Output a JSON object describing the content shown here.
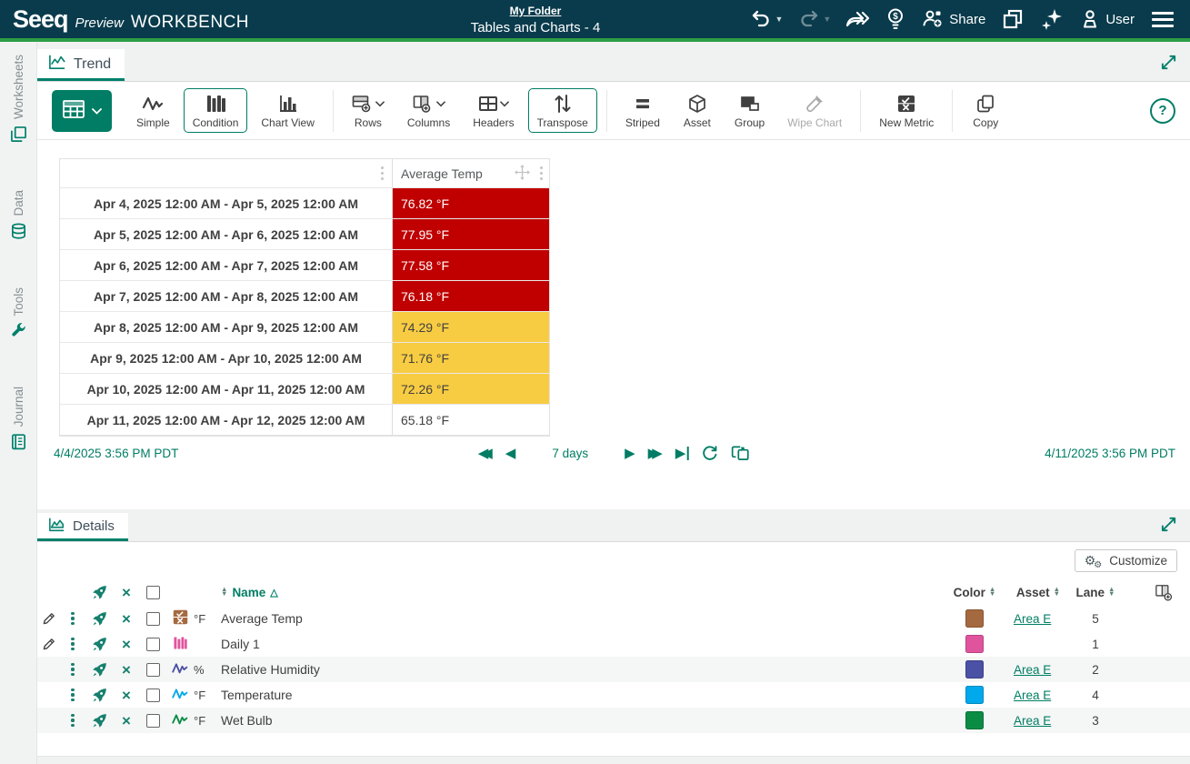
{
  "theme": {
    "accent": "#007d64",
    "header_bg": "#093b4c",
    "header_line": "#2d9e47",
    "alarm_high": "#c00000",
    "alarm_warn": "#f8cc42"
  },
  "header": {
    "brand": "Seeq",
    "preview": "Preview",
    "product": "WORKBENCH",
    "breadcrumb": "My Folder",
    "title": "Tables and Charts - 4",
    "share_label": "Share",
    "user_label": "User"
  },
  "sidebar": {
    "items": [
      {
        "label": "Worksheets"
      },
      {
        "label": "Data"
      },
      {
        "label": "Tools"
      },
      {
        "label": "Journal"
      }
    ]
  },
  "trend_panel": {
    "tab_label": "Trend",
    "toolbar": {
      "buttons": [
        {
          "label": "Simple",
          "selected": false
        },
        {
          "label": "Condition",
          "selected": true
        },
        {
          "label": "Chart View",
          "selected": false
        },
        {
          "label": "Rows",
          "selected": false
        },
        {
          "label": "Columns",
          "selected": false
        },
        {
          "label": "Headers",
          "selected": false
        },
        {
          "label": "Transpose",
          "selected": true
        },
        {
          "label": "Striped",
          "selected": false
        },
        {
          "label": "Asset",
          "selected": false
        },
        {
          "label": "Group",
          "selected": false
        },
        {
          "label": "Wipe Chart",
          "selected": false,
          "disabled": true
        },
        {
          "label": "New Metric",
          "selected": false
        },
        {
          "label": "Copy",
          "selected": false
        }
      ]
    },
    "table": {
      "value_column": "Average Temp",
      "rows": [
        {
          "range": "Apr 4, 2025 12:00 AM - Apr 5, 2025 12:00 AM",
          "value": "76.82 °F",
          "bg": "#c00000",
          "fg": "#ffffff"
        },
        {
          "range": "Apr 5, 2025 12:00 AM - Apr 6, 2025 12:00 AM",
          "value": "77.95 °F",
          "bg": "#c00000",
          "fg": "#ffffff"
        },
        {
          "range": "Apr 6, 2025 12:00 AM - Apr 7, 2025 12:00 AM",
          "value": "77.58 °F",
          "bg": "#c00000",
          "fg": "#ffffff"
        },
        {
          "range": "Apr 7, 2025 12:00 AM - Apr 8, 2025 12:00 AM",
          "value": "76.18 °F",
          "bg": "#c00000",
          "fg": "#ffffff"
        },
        {
          "range": "Apr 8, 2025 12:00 AM - Apr 9, 2025 12:00 AM",
          "value": "74.29 °F",
          "bg": "#f8cc42",
          "fg": "#404041"
        },
        {
          "range": "Apr 9, 2025 12:00 AM - Apr 10, 2025 12:00 AM",
          "value": "71.76 °F",
          "bg": "#f8cc42",
          "fg": "#404041"
        },
        {
          "range": "Apr 10, 2025 12:00 AM - Apr 11, 2025 12:00 AM",
          "value": "72.26 °F",
          "bg": "#f8cc42",
          "fg": "#404041"
        },
        {
          "range": "Apr 11, 2025 12:00 AM - Apr 12, 2025 12:00 AM",
          "value": "65.18 °F",
          "bg": "#ffffff",
          "fg": "#404041"
        }
      ]
    },
    "timebar": {
      "start": "4/4/2025 3:56 PM PDT",
      "duration": "7 days",
      "end": "4/11/2025 3:56 PM PDT"
    }
  },
  "details_panel": {
    "tab_label": "Details",
    "customize_label": "Customize",
    "columns": {
      "name": "Name",
      "color": "Color",
      "asset": "Asset",
      "lane": "Lane"
    },
    "rows": [
      {
        "type": "metric",
        "unit": "°F",
        "name": "Average Temp",
        "color": "#a5693f",
        "asset": "Area E",
        "lane": "5"
      },
      {
        "type": "condition",
        "unit": "",
        "name": "Daily 1",
        "color": "#e0549e",
        "asset": "",
        "lane": "1"
      },
      {
        "type": "signal",
        "unit": "%",
        "name": "Relative Humidity",
        "color": "#4b51a5",
        "asset": "Area E",
        "lane": "2"
      },
      {
        "type": "signal",
        "unit": "°F",
        "name": "Temperature",
        "color": "#00a8ec",
        "asset": "Area E",
        "lane": "4"
      },
      {
        "type": "signal",
        "unit": "°F",
        "name": "Wet Bulb",
        "color": "#0b8c45",
        "asset": "Area E",
        "lane": "3"
      }
    ]
  }
}
